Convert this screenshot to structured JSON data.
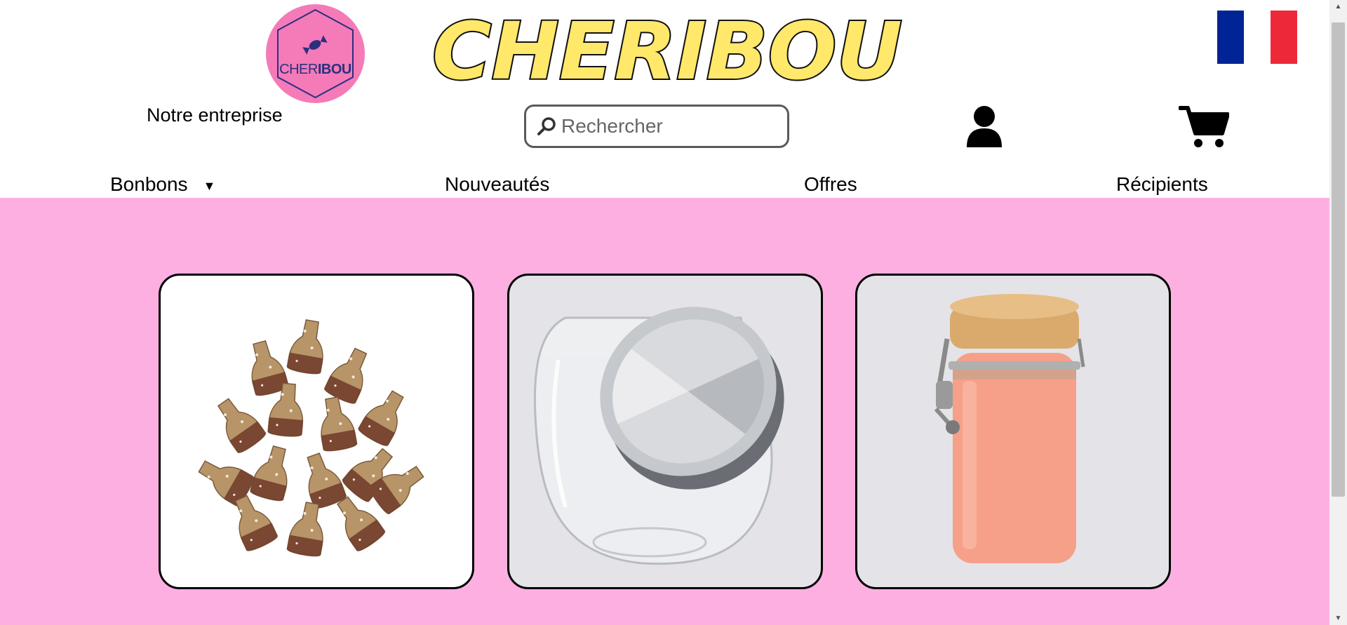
{
  "header": {
    "logo_text_part1": "CHER",
    "logo_text_part2": "IBOU",
    "brand_title": "CHERIBOU",
    "company_link": "Notre entreprise",
    "search_placeholder": "Rechercher",
    "language_flag": "flag-icon-fr",
    "icons": {
      "account": "user-icon",
      "cart": "cart-icon",
      "search": "magnifier-icon"
    }
  },
  "nav": {
    "items": [
      {
        "label": "Bonbons",
        "has_dropdown": true,
        "dropdown_glyph": "▼"
      },
      {
        "label": "Nouveautés"
      },
      {
        "label": "Offres"
      },
      {
        "label": "Récipients"
      }
    ]
  },
  "products": [
    {
      "image": "cola-bottle-gummies"
    },
    {
      "image": "glass-candy-jar-steel-lid"
    },
    {
      "image": "pink-glass-jar-bamboo-lid"
    }
  ],
  "colors": {
    "page_background": "#fdafe2",
    "logo_badge": "#f47bb8",
    "brand_fill": "#ffe86a",
    "flag_blue": "#002395",
    "flag_white": "#ffffff",
    "flag_red": "#ed2939"
  }
}
